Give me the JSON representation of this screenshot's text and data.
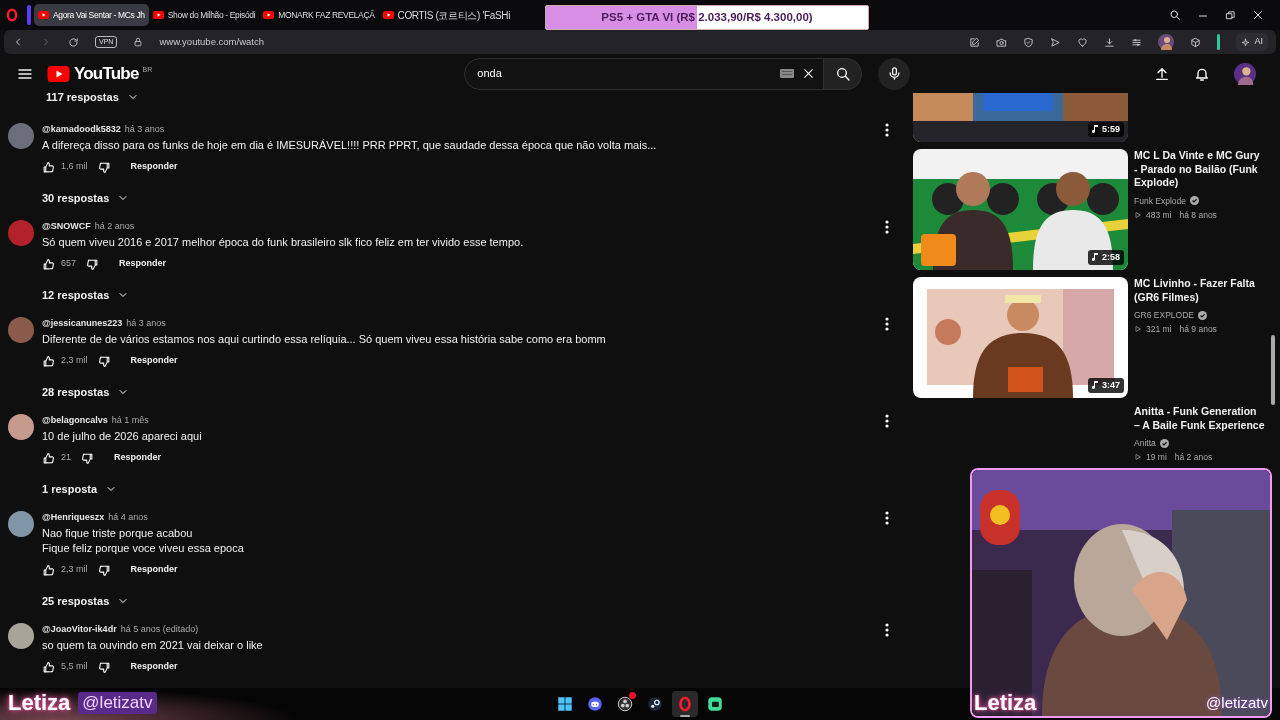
{
  "browser": {
    "tabs": [
      {
        "title": "Agora Vai Sentar - MCs Jh",
        "selected": true
      },
      {
        "title": "Show do Milhão - Episódi",
        "selected": false
      },
      {
        "title": "MONARK FAZ REVELAÇÃ",
        "selected": false
      },
      {
        "title": "CORTIS (코르티스) 'FaSHi",
        "selected": false
      }
    ],
    "vpn": "VPN",
    "address": "www.youtube.com/watch",
    "ai_button": "AI"
  },
  "donation_goal": {
    "label": "PS5 + GTA VI (R$ 2.033,90/R$ 4.300,00)",
    "level": 0.47
  },
  "header": {
    "logo": "YouTube",
    "region": "BR",
    "search": {
      "value": "onda"
    }
  },
  "comments": {
    "top_replies": "117 respostas",
    "items": [
      {
        "author": "@kamadoodk5832",
        "time": "há 3 anos",
        "lines": [
          "A difereça disso para os funks de hoje em dia é IMESURÁVEL!!!! PRR PPRT, que saudade dessa época que não volta mais..."
        ],
        "likes": "1,6 mil",
        "reply": "Responder",
        "replies": "30 respostas"
      },
      {
        "author": "@SNOWCF",
        "time": "há 2 anos",
        "lines": [
          "Só quem viveu 2016 e 2017 melhor época do funk brasileiro slk fico feliz em ter vivido esse tempo."
        ],
        "likes": "657",
        "reply": "Responder",
        "replies": "12 respostas"
      },
      {
        "author": "@jessicanunes223",
        "time": "há 3 anos",
        "lines": [
          "Diferente de de vários estamos nos aqui curtindo essa relíquia... Só quem viveu essa história sabe como era bomm"
        ],
        "likes": "2,3 mil",
        "reply": "Responder",
        "replies": "28 respostas"
      },
      {
        "author": "@belagoncalvs",
        "time": "há 1 mês",
        "lines": [
          "10 de julho de 2026 apareci aqui"
        ],
        "likes": "21",
        "reply": "Responder",
        "replies": "1 resposta"
      },
      {
        "author": "@Henriqueszx",
        "time": "há 4 anos",
        "lines": [
          "Nao fique triste porque acabou",
          "Fique feliz porque voce viveu essa epoca"
        ],
        "likes": "2,3 mil",
        "reply": "Responder",
        "replies": "25 respostas"
      },
      {
        "author": "@JoaoVitor-ik4dr",
        "time": "há 5 anos (editado)",
        "lines": [
          "so quem ta ouvindo em 2021 vai deixar o like"
        ],
        "likes": "5,5 mil",
        "reply": "Responder"
      }
    ]
  },
  "sidebar": {
    "videos": [
      {
        "kind": "partial",
        "duration": "5:59"
      },
      {
        "kind": "full",
        "title": "MC L Da Vinte e MC Gury - Parado no Bailão (Funk Explode)",
        "channel": "Funk Explode",
        "verified": true,
        "views": "483 mi",
        "age": "há 8 anos",
        "duration": "2:58"
      },
      {
        "kind": "full",
        "title": "MC Livinho - Fazer Falta (GR6 Filmes)",
        "channel": "GR6 EXPLODE",
        "verified": true,
        "views": "321 mi",
        "age": "há 9 anos",
        "duration": "3:47"
      },
      {
        "kind": "no_thumbnail",
        "title": "Anitta - Funk Generation – A Baile Funk Experience",
        "channel": "Anitta",
        "verified": true,
        "views": "19 mi",
        "age": "há 2 anos"
      }
    ]
  },
  "stream_overlay": {
    "name": "Letiza",
    "handle": "@letizatv",
    "webcam": {
      "kind": "picture",
      "name": "Letiza",
      "handle": "@letizatv"
    }
  },
  "taskbar": [
    {
      "kind": "start",
      "selected": false,
      "badge": false
    },
    {
      "kind": "chat",
      "selected": false,
      "badge": false
    },
    {
      "kind": "recorder",
      "selected": false,
      "badge": true
    },
    {
      "kind": "game",
      "selected": false,
      "badge": false
    },
    {
      "kind": "browser",
      "selected": true,
      "badge": false
    },
    {
      "kind": "app",
      "selected": false,
      "badge": false
    }
  ]
}
